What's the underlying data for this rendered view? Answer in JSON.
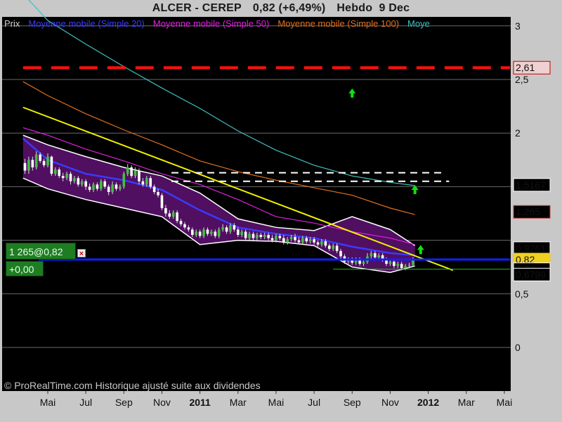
{
  "header": {
    "symbol": "ALCER - CEREP",
    "price_change": "0,82 (+6,49%)",
    "period": "Hebdo",
    "date": "9 Dec"
  },
  "legend": [
    {
      "label": "Prix",
      "color": "#d0d0d0"
    },
    {
      "label": "Moyenne mobile (Simple 20)",
      "color": "#3a3aff"
    },
    {
      "label": "Moyenne mobile (Simple 50)",
      "color": "#e020e0"
    },
    {
      "label": "Moyenne mobile (Simple 100)",
      "color": "#e07020"
    },
    {
      "label": "Moye",
      "color": "#40c0c0"
    }
  ],
  "order_panel": {
    "order": "1 265@0,82",
    "close": "×",
    "pnl": "+0,00"
  },
  "copyright": "© ProRealTime.com Historique ajusté suite aux dividendes",
  "price_tags": [
    {
      "text": "2,61",
      "value": 2.61,
      "bg": "#f0d0d0",
      "fg": "#c00000",
      "border": "#c00000"
    },
    {
      "text": "1,5167",
      "value": 1.5167,
      "bg": "#000000",
      "fg": "#ffffff",
      "border": "#ffffff"
    },
    {
      "text": "1,265",
      "value": 1.265,
      "bg": "#000000",
      "fg": "#c84040",
      "border": "#c84040"
    },
    {
      "text": "0,9261",
      "value": 0.9261,
      "bg": "#000000",
      "fg": "#ffffff",
      "border": "#ffffff"
    },
    {
      "text": "0,82",
      "value": 0.82,
      "bg": "#f0d020",
      "fg": "#000000",
      "border": "#f0d020"
    },
    {
      "text": "0,73",
      "value": 0.73,
      "bg": "#000000",
      "fg": "#ffffff",
      "border": "#ffffff"
    },
    {
      "text": "0,6799",
      "value": 0.6799,
      "bg": "#000000",
      "fg": "#ffffff",
      "border": "#ffffff"
    }
  ],
  "colors": {
    "background": "#000000",
    "frame": "#c8c8c8",
    "grid": "#6a6a6a",
    "up_candle": "#40c040",
    "down_candle": "#ffffff",
    "bollinger_fill": "#500f60",
    "bollinger_border": "#ffffff",
    "resistance": "#ff1010",
    "trendline": "#f0f000",
    "support_blue": "#1020ff",
    "support_green": "#20c020",
    "arrow": "#10e010"
  },
  "chart_data": {
    "type": "line",
    "y_scale": "linear",
    "ylim": [
      -0.2,
      3
    ],
    "y_ticks": [
      0,
      0.5,
      1,
      1.5,
      2,
      2.5,
      3
    ],
    "y_tick_labels": [
      "0",
      "0,5",
      "",
      "",
      "2",
      "2,5",
      "3"
    ],
    "x_ticks": [
      {
        "label": "Mai",
        "bold": false,
        "t": 0
      },
      {
        "label": "Jul",
        "bold": false,
        "t": 2
      },
      {
        "label": "Sep",
        "bold": false,
        "t": 4
      },
      {
        "label": "Nov",
        "bold": false,
        "t": 6
      },
      {
        "label": "2011",
        "bold": true,
        "t": 8
      },
      {
        "label": "Mar",
        "bold": false,
        "t": 10
      },
      {
        "label": "Mai",
        "bold": false,
        "t": 12
      },
      {
        "label": "Jul",
        "bold": false,
        "t": 14
      },
      {
        "label": "Sep",
        "bold": false,
        "t": 16
      },
      {
        "label": "Nov",
        "bold": false,
        "t": 18
      },
      {
        "label": "2012",
        "bold": true,
        "t": 20
      },
      {
        "label": "Mar",
        "bold": false,
        "t": 22
      },
      {
        "label": "Mai",
        "bold": false,
        "t": 24
      }
    ],
    "xlim": [
      -1.3,
      25
    ],
    "series": [
      {
        "name": "Prix",
        "type": "candlestick",
        "x": [
          -1.2,
          -1.0,
          -0.8,
          -0.6,
          -0.4,
          -0.2,
          0.0,
          0.2,
          0.4,
          0.6,
          0.8,
          1.0,
          1.2,
          1.4,
          1.6,
          1.8,
          2.0,
          2.2,
          2.4,
          2.6,
          2.8,
          3.0,
          3.2,
          3.4,
          3.6,
          3.8,
          4.0,
          4.2,
          4.4,
          4.6,
          4.8,
          5.0,
          5.2,
          5.4,
          5.6,
          5.8,
          6.0,
          6.2,
          6.4,
          6.6,
          6.8,
          7.0,
          7.2,
          7.4,
          7.6,
          7.8,
          8.0,
          8.2,
          8.4,
          8.6,
          8.8,
          9.0,
          9.2,
          9.4,
          9.6,
          9.8,
          10.0,
          10.2,
          10.4,
          10.6,
          10.8,
          11.0,
          11.2,
          11.4,
          11.6,
          11.8,
          12.0,
          12.2,
          12.4,
          12.6,
          12.8,
          13.0,
          13.2,
          13.4,
          13.6,
          13.8,
          14.0,
          14.2,
          14.4,
          14.6,
          14.8,
          15.0,
          15.2,
          15.4,
          15.6,
          15.8,
          16.0,
          16.2,
          16.4,
          16.6,
          16.8,
          17.0,
          17.2,
          17.4,
          17.6,
          17.8,
          18.0,
          18.2,
          18.4,
          18.6,
          18.8,
          19.0,
          19.2
        ],
        "open": [
          1.72,
          1.65,
          1.75,
          1.68,
          1.8,
          1.74,
          1.7,
          1.78,
          1.62,
          1.66,
          1.6,
          1.58,
          1.62,
          1.55,
          1.58,
          1.52,
          1.55,
          1.5,
          1.47,
          1.52,
          1.48,
          1.55,
          1.5,
          1.45,
          1.52,
          1.48,
          1.5,
          1.62,
          1.68,
          1.6,
          1.65,
          1.55,
          1.52,
          1.58,
          1.5,
          1.45,
          1.42,
          1.3,
          1.25,
          1.22,
          1.26,
          1.18,
          1.15,
          1.12,
          1.1,
          1.05,
          1.08,
          1.04,
          1.1,
          1.06,
          1.08,
          1.04,
          1.1,
          1.12,
          1.08,
          1.14,
          1.1,
          1.05,
          1.08,
          1.02,
          1.06,
          1.02,
          1.05,
          1.03,
          1.05,
          1.02,
          1.0,
          1.04,
          1.02,
          0.98,
          1.01,
          1.03,
          1.0,
          0.98,
          1.02,
          0.99,
          1.01,
          0.98,
          0.96,
          0.99,
          0.95,
          0.92,
          0.95,
          0.9,
          0.85,
          0.8,
          0.82,
          0.79,
          0.82,
          0.78,
          0.8,
          0.85,
          0.88,
          0.84,
          0.86,
          0.82,
          0.78,
          0.8,
          0.76,
          0.78,
          0.74,
          0.76,
          0.77
        ],
        "close": [
          1.65,
          1.75,
          1.68,
          1.8,
          1.74,
          1.7,
          1.78,
          1.62,
          1.66,
          1.6,
          1.58,
          1.62,
          1.55,
          1.58,
          1.52,
          1.55,
          1.5,
          1.47,
          1.52,
          1.48,
          1.55,
          1.5,
          1.45,
          1.52,
          1.48,
          1.5,
          1.62,
          1.68,
          1.6,
          1.65,
          1.55,
          1.52,
          1.58,
          1.5,
          1.45,
          1.42,
          1.3,
          1.25,
          1.22,
          1.26,
          1.18,
          1.15,
          1.12,
          1.1,
          1.05,
          1.08,
          1.04,
          1.1,
          1.06,
          1.08,
          1.04,
          1.1,
          1.12,
          1.08,
          1.14,
          1.1,
          1.05,
          1.08,
          1.02,
          1.06,
          1.02,
          1.05,
          1.03,
          1.05,
          1.02,
          1.0,
          1.04,
          1.02,
          0.98,
          1.01,
          1.03,
          1.0,
          0.98,
          1.02,
          0.99,
          1.01,
          0.98,
          0.96,
          0.99,
          0.95,
          0.92,
          0.95,
          0.9,
          0.85,
          0.8,
          0.82,
          0.79,
          0.82,
          0.78,
          0.8,
          0.85,
          0.88,
          0.84,
          0.86,
          0.82,
          0.78,
          0.8,
          0.76,
          0.78,
          0.74,
          0.76,
          0.77,
          0.82
        ],
        "high": [
          1.76,
          1.78,
          1.78,
          1.83,
          1.82,
          1.76,
          1.81,
          1.79,
          1.68,
          1.68,
          1.63,
          1.64,
          1.64,
          1.6,
          1.6,
          1.57,
          1.57,
          1.53,
          1.54,
          1.54,
          1.57,
          1.57,
          1.52,
          1.55,
          1.54,
          1.52,
          1.64,
          1.71,
          1.7,
          1.68,
          1.67,
          1.58,
          1.6,
          1.6,
          1.52,
          1.48,
          1.44,
          1.33,
          1.28,
          1.28,
          1.28,
          1.2,
          1.17,
          1.14,
          1.12,
          1.1,
          1.1,
          1.12,
          1.12,
          1.1,
          1.1,
          1.12,
          1.15,
          1.14,
          1.16,
          1.16,
          1.12,
          1.1,
          1.1,
          1.08,
          1.08,
          1.07,
          1.07,
          1.07,
          1.07,
          1.05,
          1.06,
          1.06,
          1.05,
          1.03,
          1.05,
          1.06,
          1.03,
          1.04,
          1.04,
          1.03,
          1.03,
          1.0,
          1.01,
          1.01,
          0.97,
          0.97,
          0.97,
          0.92,
          0.87,
          0.84,
          0.84,
          0.84,
          0.84,
          0.82,
          0.88,
          0.9,
          0.9,
          0.88,
          0.88,
          0.84,
          0.82,
          0.82,
          0.8,
          0.8,
          0.78,
          0.79,
          0.84
        ],
        "low": [
          1.62,
          1.62,
          1.65,
          1.66,
          1.72,
          1.68,
          1.68,
          1.6,
          1.6,
          1.58,
          1.55,
          1.56,
          1.52,
          1.53,
          1.5,
          1.5,
          1.47,
          1.45,
          1.45,
          1.46,
          1.46,
          1.48,
          1.42,
          1.43,
          1.46,
          1.46,
          1.48,
          1.6,
          1.58,
          1.58,
          1.52,
          1.5,
          1.5,
          1.48,
          1.43,
          1.4,
          1.28,
          1.22,
          1.2,
          1.2,
          1.16,
          1.13,
          1.1,
          1.08,
          1.03,
          1.03,
          1.02,
          1.02,
          1.04,
          1.04,
          1.02,
          1.02,
          1.08,
          1.06,
          1.06,
          1.08,
          1.03,
          1.03,
          1.0,
          1.0,
          1.0,
          1.0,
          1.01,
          1.01,
          1.0,
          0.98,
          0.98,
          1.0,
          0.96,
          0.96,
          0.99,
          0.98,
          0.96,
          0.96,
          0.97,
          0.97,
          0.96,
          0.94,
          0.94,
          0.93,
          0.9,
          0.9,
          0.88,
          0.83,
          0.78,
          0.78,
          0.77,
          0.77,
          0.76,
          0.76,
          0.78,
          0.83,
          0.82,
          0.82,
          0.8,
          0.76,
          0.76,
          0.74,
          0.74,
          0.72,
          0.72,
          0.74,
          0.75
        ]
      },
      {
        "name": "Moyenne mobile (Simple 20)",
        "x": [
          -1.3,
          0,
          2,
          4,
          6,
          8,
          10,
          12,
          14,
          16,
          18,
          19.3
        ],
        "values": [
          1.95,
          1.75,
          1.62,
          1.56,
          1.47,
          1.28,
          1.12,
          1.06,
          1.02,
          0.94,
          0.88,
          0.86
        ]
      },
      {
        "name": "Moyenne mobile (Simple 50)",
        "x": [
          -1.3,
          0,
          2,
          4,
          6,
          8,
          10,
          12,
          14,
          16,
          18,
          19.3
        ],
        "values": [
          2.05,
          1.98,
          1.85,
          1.74,
          1.62,
          1.52,
          1.38,
          1.22,
          1.16,
          1.08,
          1.02,
          0.96
        ]
      },
      {
        "name": "Moyenne mobile (Simple 100)",
        "x": [
          -1.3,
          0,
          2,
          4,
          6,
          8,
          10,
          12,
          14,
          16,
          18,
          19.3
        ],
        "values": [
          2.48,
          2.35,
          2.18,
          2.03,
          1.89,
          1.74,
          1.64,
          1.56,
          1.49,
          1.42,
          1.3,
          1.24
        ]
      },
      {
        "name": "Moye",
        "x": [
          -1.3,
          0,
          2,
          4,
          6,
          8,
          10,
          12,
          14,
          16,
          18,
          19.3
        ],
        "values": [
          3.3,
          3.05,
          2.83,
          2.62,
          2.42,
          2.23,
          2.02,
          1.84,
          1.7,
          1.6,
          1.54,
          1.51
        ]
      },
      {
        "name": "Bollinger haut",
        "x": [
          -1.3,
          0,
          2,
          4,
          6,
          8,
          10,
          12,
          14,
          16,
          18,
          19.3
        ],
        "values": [
          1.98,
          1.89,
          1.78,
          1.68,
          1.6,
          1.44,
          1.2,
          1.12,
          1.09,
          1.22,
          1.1,
          0.95
        ]
      },
      {
        "name": "Bollinger bas",
        "x": [
          -1.3,
          0,
          2,
          4,
          6,
          8,
          10,
          12,
          14,
          16,
          18,
          19.3
        ],
        "values": [
          1.58,
          1.48,
          1.38,
          1.3,
          1.22,
          0.96,
          1.0,
          0.99,
          0.95,
          0.75,
          0.7,
          0.76
        ]
      }
    ],
    "lines": {
      "resistance": {
        "value": 2.61,
        "x": [
          -1.3,
          24.3
        ]
      },
      "trendline": {
        "x": [
          -1.3,
          21.3
        ],
        "values": [
          2.24,
          0.72
        ]
      },
      "support_blue": {
        "value": 0.82,
        "x": [
          -0.5,
          24.3
        ]
      },
      "support_green": {
        "value": 0.73,
        "x": [
          15.0,
          24.3
        ]
      },
      "range_white_1": {
        "value": 1.63,
        "x": [
          6.5,
          20.8
        ]
      },
      "range_white_2": {
        "value": 1.55,
        "x": [
          6.5,
          21.1
        ]
      },
      "arrows": [
        {
          "x": 16.0,
          "y": 2.37
        },
        {
          "x": 19.3,
          "y": 1.47
        },
        {
          "x": 19.6,
          "y": 0.91
        }
      ]
    }
  }
}
